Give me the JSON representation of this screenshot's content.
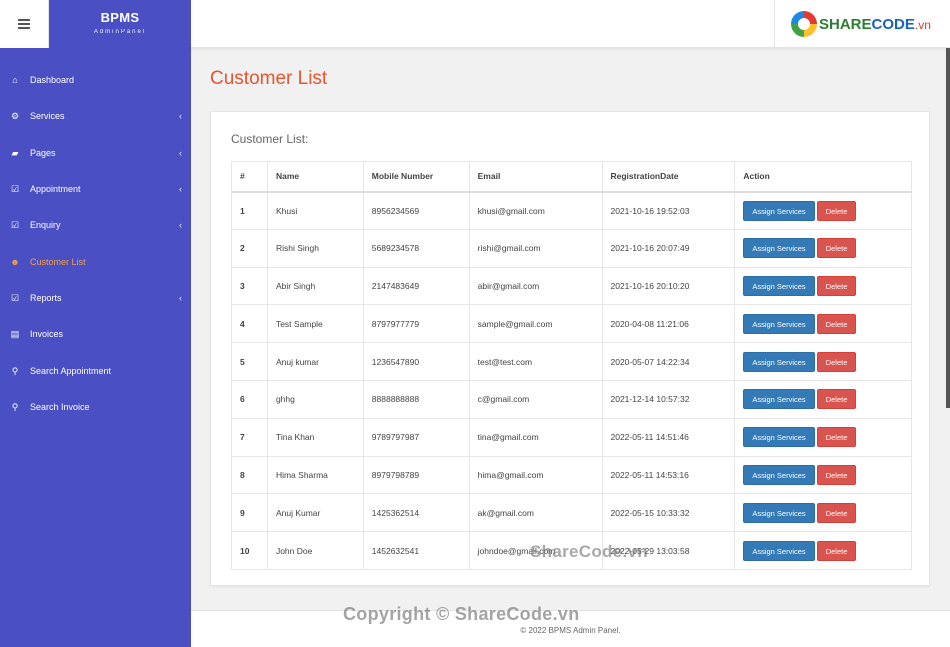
{
  "header": {
    "brand_name": "BPMS",
    "brand_sub": "AdminPanel",
    "logo_text_share": "SHARE",
    "logo_text_code": "CODE",
    "logo_text_vn": ".vn"
  },
  "sidebar": {
    "items": [
      {
        "label": "Dashboard",
        "icon": "home-icon",
        "glyph": "⌂",
        "has_chevron": false,
        "active": false
      },
      {
        "label": "Services",
        "icon": "cogs-icon",
        "glyph": "⚙",
        "has_chevron": true,
        "active": false
      },
      {
        "label": "Pages",
        "icon": "book-icon",
        "glyph": "▰",
        "has_chevron": true,
        "active": false
      },
      {
        "label": "Appointment",
        "icon": "checkbox-icon",
        "glyph": "☑",
        "has_chevron": true,
        "active": false
      },
      {
        "label": "Enquiry",
        "icon": "checkbox-icon",
        "glyph": "☑",
        "has_chevron": true,
        "active": false
      },
      {
        "label": "Customer List",
        "icon": "users-icon",
        "glyph": "☻",
        "has_chevron": false,
        "active": true
      },
      {
        "label": "Reports",
        "icon": "checkbox-icon",
        "glyph": "☑",
        "has_chevron": true,
        "active": false
      },
      {
        "label": "Invoices",
        "icon": "file-icon",
        "glyph": "▤",
        "has_chevron": false,
        "active": false
      },
      {
        "label": "Search Appointment",
        "icon": "search-icon",
        "glyph": "⚲",
        "has_chevron": false,
        "active": false
      },
      {
        "label": "Search Invoice",
        "icon": "search-icon",
        "glyph": "⚲",
        "has_chevron": false,
        "active": false
      }
    ],
    "chevron_glyph": "‹"
  },
  "main": {
    "page_title": "Customer List",
    "card_title": "Customer List:",
    "columns": [
      "#",
      "Name",
      "Mobile Number",
      "Email",
      "RegistrationDate",
      "Action"
    ],
    "assign_label": "Assign Services",
    "delete_label": "Delete",
    "rows": [
      {
        "num": "1",
        "name": "Khusi",
        "mobile": "8956234569",
        "email": "khusi@gmail.com",
        "date": "2021-10-16 19:52:03"
      },
      {
        "num": "2",
        "name": "Rishi Singh",
        "mobile": "5689234578",
        "email": "rishi@gmail.com",
        "date": "2021-10-16 20:07:49"
      },
      {
        "num": "3",
        "name": "Abir Singh",
        "mobile": "2147483649",
        "email": "abir@gmail.com",
        "date": "2021-10-16 20:10:20"
      },
      {
        "num": "4",
        "name": "Test Sample",
        "mobile": "8797977779",
        "email": "sample@gmail.com",
        "date": "2020-04-08 11:21:06"
      },
      {
        "num": "5",
        "name": "Anuj kumar",
        "mobile": "1236547890",
        "email": "test@test.com",
        "date": "2020-05-07 14:22:34"
      },
      {
        "num": "6",
        "name": "ghhg",
        "mobile": "8888888888",
        "email": "c@gmail.com",
        "date": "2021-12-14 10:57:32"
      },
      {
        "num": "7",
        "name": "Tina Khan",
        "mobile": "9789797987",
        "email": "tina@gmail.com",
        "date": "2022-05-11 14:51:46"
      },
      {
        "num": "8",
        "name": "Hima Sharma",
        "mobile": "8979798789",
        "email": "hima@gmail.com",
        "date": "2022-05-11 14:53:16"
      },
      {
        "num": "9",
        "name": "Anuj Kumar",
        "mobile": "1425362514",
        "email": "ak@gmail.com",
        "date": "2022-05-15 10:33:32"
      },
      {
        "num": "10",
        "name": "John Doe",
        "mobile": "1452632541",
        "email": "johndoe@gmail.com",
        "date": "2022-05-29 13:03:58"
      }
    ]
  },
  "footer": {
    "copyright": "© 2022 BPMS Admin Panel."
  },
  "watermarks": {
    "wm1": "ShareCode.vn",
    "wm2": "Copyright © ShareCode.vn"
  },
  "colors": {
    "sidebar_bg": "#4a4fc4",
    "title_accent": "#e8542e",
    "active_nav": "#f0a04b",
    "assign_btn": "#337ab7",
    "delete_btn": "#d9534f"
  }
}
